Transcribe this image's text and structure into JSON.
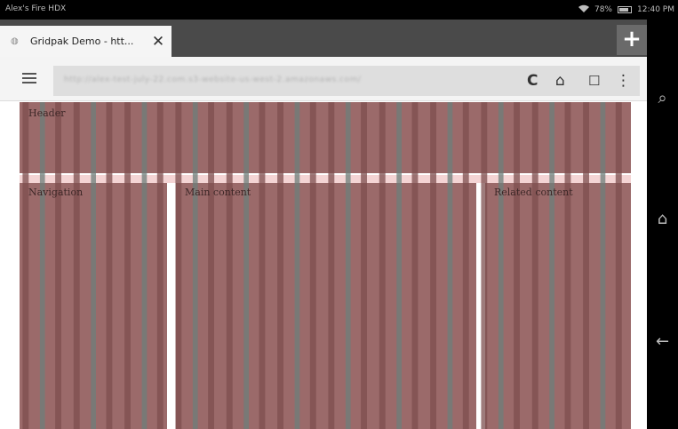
{
  "status_bar": {
    "device_name": "Alex's Fire HDX",
    "battery": "78%",
    "time": "12:40 PM",
    "icons": [
      "wifi-icon",
      "battery-icon"
    ]
  },
  "browser": {
    "tab": {
      "title": "Gridpak Demo - htt...",
      "favicon": "globe-icon",
      "close_glyph": "✕"
    },
    "new_tab_glyph": "+",
    "url": "http://alex-test-july-22.com.s3-website-us-west-2.amazonaws.com/",
    "toolbar_icons": {
      "reload": "C",
      "home": "⌂",
      "bookmark": "☐",
      "more": "⋮",
      "menu": "hamburger-icon"
    }
  },
  "page": {
    "header_label": "Header",
    "nav_label": "Navigation",
    "main_label": "Main content",
    "related_label": "Related content",
    "colors": {
      "region_fill": "#9b6a6a",
      "column_dark": "#7e4f4f",
      "column_teal": "#6d7f7b",
      "gutter": "#f4d4d4"
    }
  },
  "system_nav": {
    "search": "⌕",
    "home": "⌂",
    "back": "←"
  }
}
